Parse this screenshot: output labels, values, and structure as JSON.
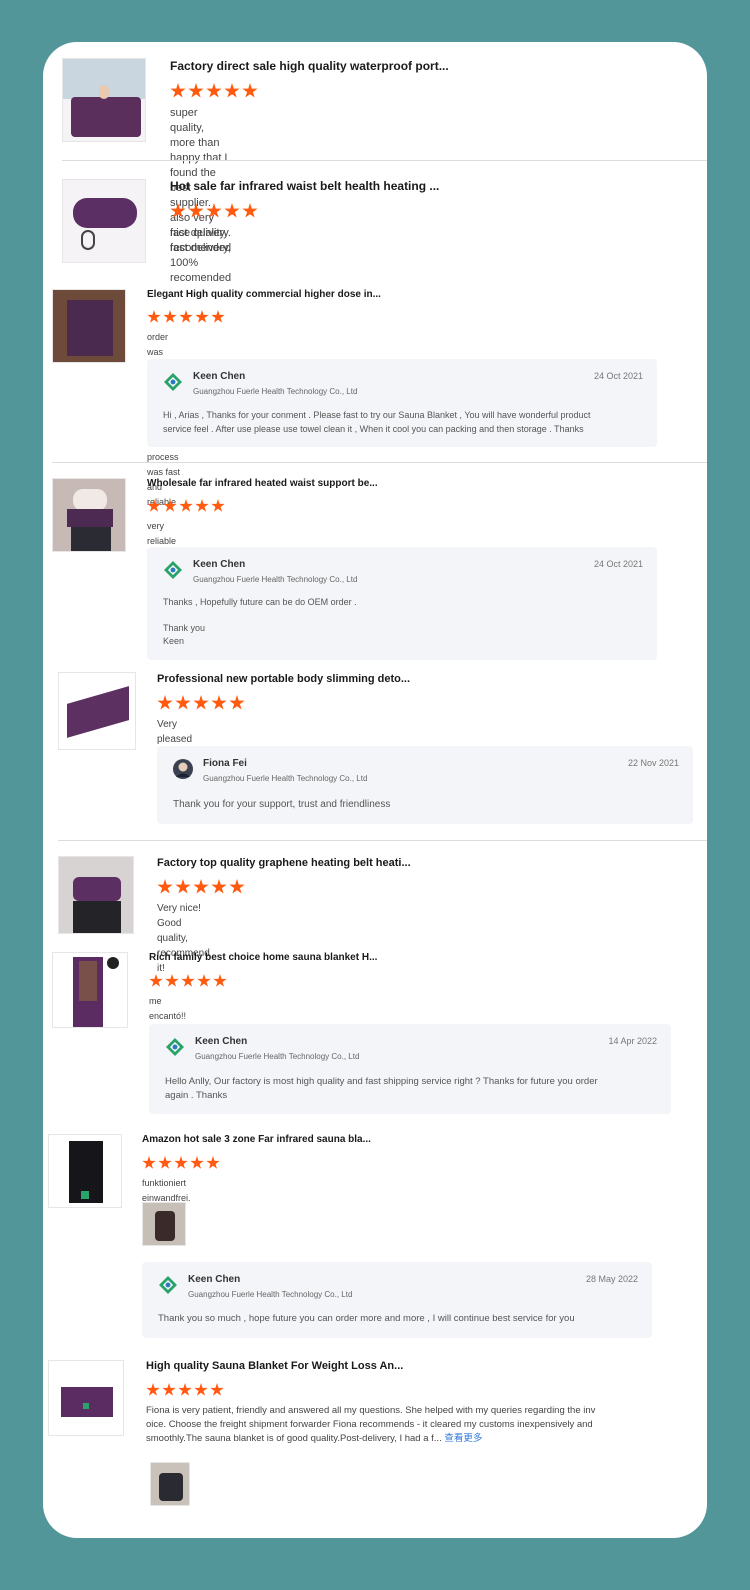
{
  "colors": {
    "background": "#52969a",
    "star": "#ff5a10",
    "reply_bg": "#f4f5f8",
    "link": "#2f7ad6"
  },
  "reviews": [
    {
      "title": "Factory direct sale high quality waterproof port...",
      "stars": 5,
      "comment": "super quality, more than happy that I found the best supplier. also very fast delivery. recomended"
    },
    {
      "title": "Hot sale far infrared waist belt health heating ...",
      "stars": 5,
      "comment": "nice quality, fast delivery, 100% recomended"
    },
    {
      "title": "Elegant High quality commercial higher dose in...",
      "stars": 5,
      "comment": "order was delivered quick haven't tried it but the whole process was fast and reliable",
      "reply": {
        "name": "Keen Chen",
        "company": "Guangzhou Fuerle Health Technology Co., Ltd",
        "date": "24 Oct 2021",
        "lines": [
          "Hi , Arias , Thanks for your conment . Please fast to try our Sauna Blanket , You will have wonderful product",
          "service feel . After use please use towel clean it , When it cool you can packing and then storage .  Thanks"
        ]
      }
    },
    {
      "title": "Wholesale far infrared heated waist support be...",
      "stars": 5,
      "comment": "very reliable and quick",
      "reply": {
        "name": "Keen Chen",
        "company": "Guangzhou Fuerle Health Technology Co., Ltd",
        "date": "24 Oct 2021",
        "lines": [
          "Thanks , Hopefully future can be do OEM order .",
          "",
          "Thank you",
          "Keen"
        ]
      }
    },
    {
      "title": "Professional new portable body slimming deto...",
      "stars": 5,
      "comment": "Very pleased about it. Really good quality!",
      "reply": {
        "name": "Fiona Fei",
        "company": "Guangzhou Fuerle Health Technology Co., Ltd",
        "date": "22 Nov 2021",
        "lines": [
          "Thank you for your support, trust and friendliness"
        ]
      }
    },
    {
      "title": "Factory top quality graphene heating belt heati...",
      "stars": 5,
      "comment": "Very nice! Good quality, recommend it!"
    },
    {
      "title": "Rich family best choice home sauna blanket H...",
      "stars": 5,
      "comment": "me encantó!!",
      "reply": {
        "name": "Keen Chen",
        "company": "Guangzhou Fuerle Health Technology Co., Ltd",
        "date": "14 Apr 2022",
        "lines": [
          "Hello Anlly, Our factory is most high quality and fast shipping service right ?  Thanks for future you order",
          "again .  Thanks"
        ]
      }
    },
    {
      "title": "Amazon hot sale 3 zone Far infrared sauna bla...",
      "stars": 5,
      "comment": "funktioniert einwandfrei. Sehr gute Qualität!",
      "reply": {
        "name": "Keen Chen",
        "company": "Guangzhou Fuerle Health Technology Co., Ltd",
        "date": "28 May 2022",
        "lines": [
          "Thank you so much , hope future you can order more and more , I will continue best service for you"
        ]
      }
    },
    {
      "title": "High quality Sauna Blanket For Weight Loss An...",
      "stars": 5,
      "comment_lines": [
        "Fiona is very patient, friendly and answered all my questions. She helped with my queries regarding the inv",
        "oice. Choose the freight shipment forwarder Fiona recommends - it cleared my customs inexpensively and",
        "smoothly.The sauna blanket is of good quality.Post-delivery, I had a f..."
      ],
      "more_label": "查看更多"
    }
  ]
}
